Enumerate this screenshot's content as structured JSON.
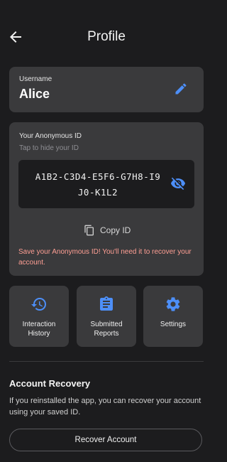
{
  "header": {
    "title": "Profile",
    "back_icon": "arrow-left-icon"
  },
  "user": {
    "label": "Username",
    "name": "Alice",
    "edit_icon": "pencil-icon"
  },
  "anonymous": {
    "label": "Your Anonymous ID",
    "hint": "Tap to hide your ID",
    "id_line1": "A1B2-C3D4-E5F6-G7H8-I9",
    "id_line2": "J0-K1L2",
    "visibility_icon": "eye-off-icon",
    "copy_label": "Copy ID",
    "copy_icon": "copy-icon",
    "warning": "Save your Anonymous ID! You'll need it to recover your account."
  },
  "tiles": [
    {
      "line1": "Interaction",
      "line2": "History",
      "icon": "history-icon"
    },
    {
      "line1": "Submitted",
      "line2": "Reports",
      "icon": "clipboard-icon"
    },
    {
      "line1": "Settings",
      "line2": "",
      "icon": "gear-icon"
    }
  ],
  "recovery": {
    "title": "Account Recovery",
    "description": "If you reinstalled the app, you can recover your account using your saved ID.",
    "button_label": "Recover Account"
  },
  "colors": {
    "background": "#1c1c1e",
    "card": "#3a3a3c",
    "accent": "#4d8ff8",
    "warning": "#ff9f94"
  }
}
